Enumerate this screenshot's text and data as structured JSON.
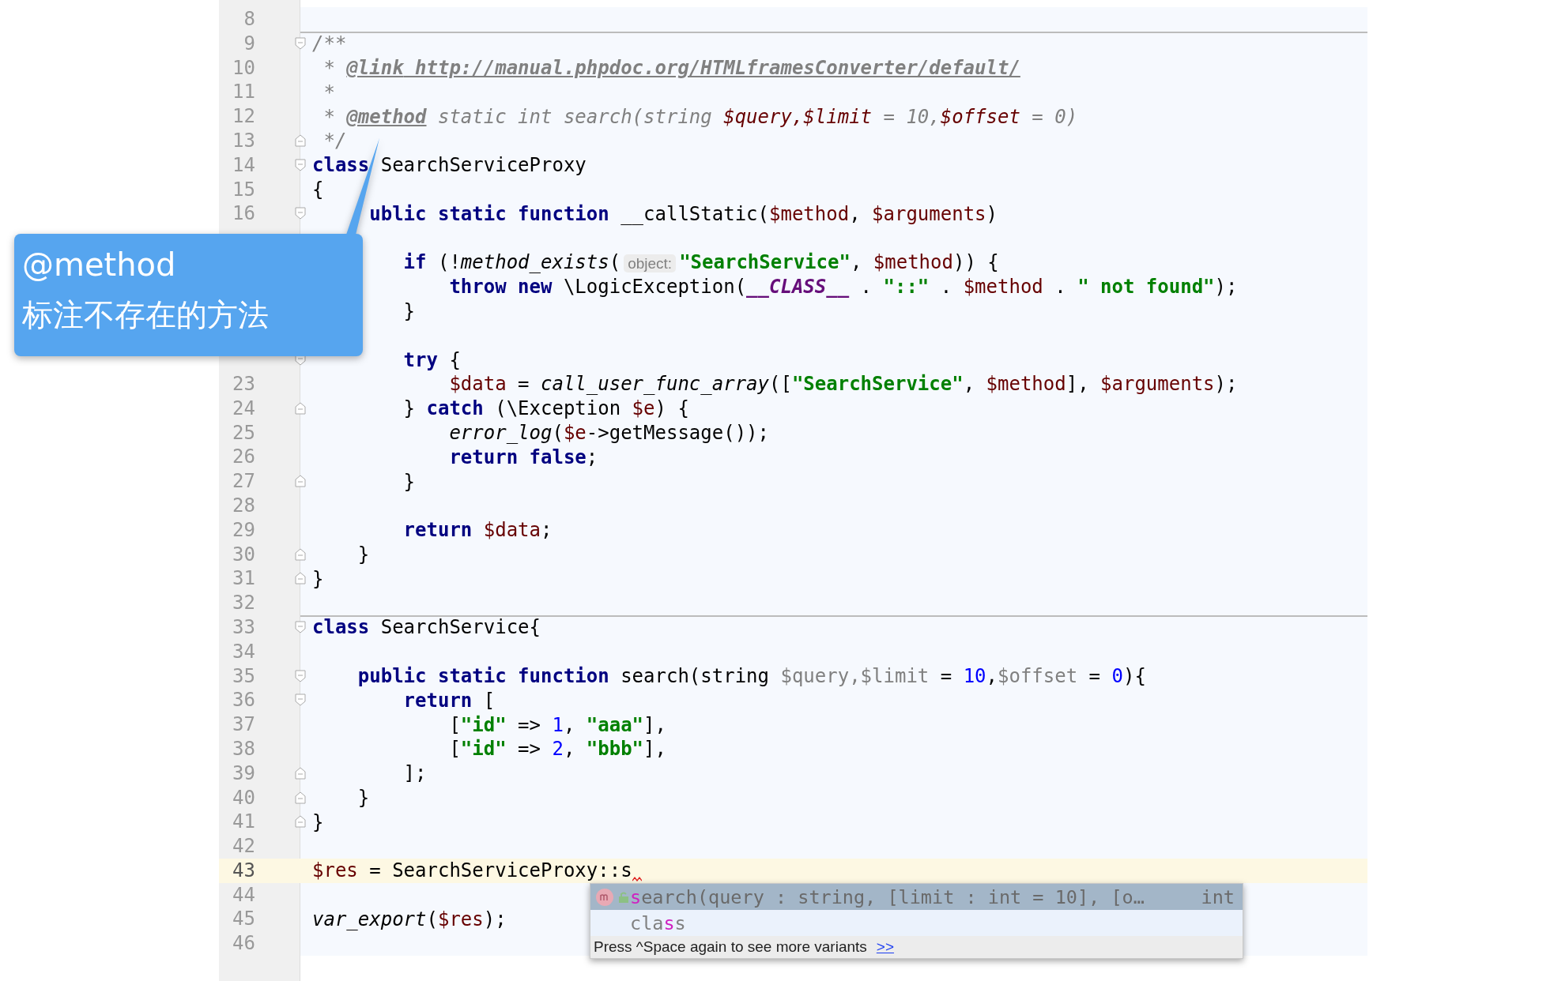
{
  "editor": {
    "lines": [
      {
        "number": "8",
        "fold_start": false,
        "fold_end": false,
        "separator": false,
        "current": false,
        "error_mark": false
      },
      {
        "number": "9",
        "fold_start": true,
        "fold_end": false,
        "separator": true,
        "current": false,
        "error_mark": false,
        "tokens": [
          {
            "kind": "comment",
            "text": "/**"
          }
        ]
      },
      {
        "number": "10",
        "fold_start": false,
        "fold_end": false,
        "separator": false,
        "current": false,
        "error_mark": false,
        "tokens": [
          {
            "kind": "comment",
            "text": " * "
          },
          {
            "kind": "doctag",
            "text": "@link"
          },
          {
            "kind": "doctag",
            "text": " http://manual.phpdoc.org/HTMLframesConverter/default/"
          }
        ]
      },
      {
        "number": "11",
        "fold_start": false,
        "fold_end": false,
        "separator": false,
        "current": false,
        "error_mark": false,
        "tokens": [
          {
            "kind": "comment",
            "text": " *"
          }
        ]
      },
      {
        "number": "12",
        "fold_start": false,
        "fold_end": false,
        "separator": false,
        "current": false,
        "error_mark": false,
        "tokens": [
          {
            "kind": "comment",
            "text": " * "
          },
          {
            "kind": "doctag",
            "text": "@method"
          },
          {
            "kind": "comment",
            "text": " static int search(string "
          },
          {
            "kind": "docvar",
            "text": "$query,$limit"
          },
          {
            "kind": "comment",
            "text": " = 10,"
          },
          {
            "kind": "docvar",
            "text": "$offset"
          },
          {
            "kind": "comment",
            "text": " = 0)"
          }
        ]
      },
      {
        "number": "13",
        "fold_start": false,
        "fold_end": true,
        "separator": false,
        "current": false,
        "error_mark": false,
        "tokens": [
          {
            "kind": "comment",
            "text": " */"
          }
        ]
      },
      {
        "number": "14",
        "fold_start": true,
        "fold_end": false,
        "separator": false,
        "current": false,
        "error_mark": false,
        "tokens": [
          {
            "kind": "keyword",
            "text": "class"
          },
          {
            "kind": "plain",
            "text": " SearchServiceProxy"
          }
        ]
      },
      {
        "number": "15",
        "fold_start": false,
        "fold_end": false,
        "separator": false,
        "current": false,
        "error_mark": false,
        "tokens": [
          {
            "kind": "plain",
            "text": "{"
          }
        ]
      },
      {
        "number": "16",
        "fold_start": true,
        "fold_end": false,
        "separator": false,
        "current": false,
        "error_mark": false,
        "tokens": [
          {
            "kind": "keyword",
            "text": "     ublic"
          },
          {
            "kind": "keyword",
            "text": " static"
          },
          {
            "kind": "keyword",
            "text": " function"
          },
          {
            "kind": "plain",
            "text": " __callStatic("
          },
          {
            "kind": "variable",
            "text": "$method"
          },
          {
            "kind": "plain",
            "text": ", "
          },
          {
            "kind": "variable",
            "text": "$arguments"
          },
          {
            "kind": "plain",
            "text": ")"
          }
        ]
      },
      {
        "fold_start": false,
        "fold_end": false,
        "separator": false,
        "current": false,
        "error_mark": false
      },
      {
        "fold_start": false,
        "fold_end": false,
        "separator": false,
        "current": false,
        "error_mark": false,
        "tokens": [
          {
            "kind": "keyword",
            "text": "        if"
          },
          {
            "kind": "plain",
            "text": " (!"
          },
          {
            "kind": "function",
            "text": "method_exists"
          },
          {
            "kind": "plain",
            "text": "("
          },
          {
            "kind": "hint",
            "text": "object:"
          },
          {
            "kind": "string",
            "text": "\"SearchService\""
          },
          {
            "kind": "plain",
            "text": ", "
          },
          {
            "kind": "variable",
            "text": "$method"
          },
          {
            "kind": "plain",
            "text": ")) {"
          }
        ]
      },
      {
        "fold_start": false,
        "fold_end": false,
        "separator": false,
        "current": false,
        "error_mark": false,
        "tokens": [
          {
            "kind": "keyword",
            "text": "            throw"
          },
          {
            "kind": "keyword",
            "text": " new"
          },
          {
            "kind": "plain",
            "text": " \\LogicException("
          },
          {
            "kind": "constant",
            "text": "__CLASS__"
          },
          {
            "kind": "plain",
            "text": " . "
          },
          {
            "kind": "string",
            "text": "\"::\""
          },
          {
            "kind": "plain",
            "text": " . "
          },
          {
            "kind": "variable",
            "text": "$method"
          },
          {
            "kind": "plain",
            "text": " . "
          },
          {
            "kind": "string",
            "text": "\" not found\""
          },
          {
            "kind": "plain",
            "text": ");"
          }
        ]
      },
      {
        "fold_start": false,
        "fold_end": false,
        "separator": false,
        "current": false,
        "error_mark": false,
        "tokens": [
          {
            "kind": "plain",
            "text": "        }"
          }
        ]
      },
      {
        "fold_start": false,
        "fold_end": false,
        "separator": false,
        "current": false,
        "error_mark": false
      },
      {
        "fold_start": true,
        "fold_end": false,
        "separator": false,
        "current": false,
        "error_mark": false,
        "tokens": [
          {
            "kind": "keyword",
            "text": "        try"
          },
          {
            "kind": "plain",
            "text": " {"
          }
        ]
      },
      {
        "number": "23",
        "fold_start": false,
        "fold_end": false,
        "separator": false,
        "current": false,
        "error_mark": false,
        "tokens": [
          {
            "kind": "variable",
            "text": "            $data"
          },
          {
            "kind": "plain",
            "text": " = "
          },
          {
            "kind": "function",
            "text": "call_user_func_array"
          },
          {
            "kind": "plain",
            "text": "(["
          },
          {
            "kind": "string",
            "text": "\"SearchService\""
          },
          {
            "kind": "plain",
            "text": ", "
          },
          {
            "kind": "variable",
            "text": "$method"
          },
          {
            "kind": "plain",
            "text": "], "
          },
          {
            "kind": "variable",
            "text": "$arguments"
          },
          {
            "kind": "plain",
            "text": ");"
          }
        ]
      },
      {
        "number": "24",
        "fold_start": false,
        "fold_end": true,
        "separator": false,
        "current": false,
        "error_mark": false,
        "tokens": [
          {
            "kind": "plain",
            "text": "        } "
          },
          {
            "kind": "keyword",
            "text": "catch"
          },
          {
            "kind": "plain",
            "text": " (\\Exception "
          },
          {
            "kind": "variable",
            "text": "$e"
          },
          {
            "kind": "plain",
            "text": ") {"
          }
        ]
      },
      {
        "number": "25",
        "fold_start": false,
        "fold_end": false,
        "separator": false,
        "current": false,
        "error_mark": false,
        "tokens": [
          {
            "kind": "function",
            "text": "            error_log"
          },
          {
            "kind": "plain",
            "text": "("
          },
          {
            "kind": "variable",
            "text": "$e"
          },
          {
            "kind": "plain",
            "text": "->getMessage());"
          }
        ]
      },
      {
        "number": "26",
        "fold_start": false,
        "fold_end": false,
        "separator": false,
        "current": false,
        "error_mark": false,
        "tokens": [
          {
            "kind": "keyword",
            "text": "            return"
          },
          {
            "kind": "keyword",
            "text": " false"
          },
          {
            "kind": "plain",
            "text": ";"
          }
        ]
      },
      {
        "number": "27",
        "fold_start": false,
        "fold_end": true,
        "separator": false,
        "current": false,
        "error_mark": false,
        "tokens": [
          {
            "kind": "plain",
            "text": "        }"
          }
        ]
      },
      {
        "number": "28",
        "fold_start": false,
        "fold_end": false,
        "separator": false,
        "current": false,
        "error_mark": false
      },
      {
        "number": "29",
        "fold_start": false,
        "fold_end": false,
        "separator": false,
        "current": false,
        "error_mark": false,
        "tokens": [
          {
            "kind": "keyword",
            "text": "        return"
          },
          {
            "kind": "variable",
            "text": " $data"
          },
          {
            "kind": "plain",
            "text": ";"
          }
        ]
      },
      {
        "number": "30",
        "fold_start": false,
        "fold_end": true,
        "separator": false,
        "current": false,
        "error_mark": false,
        "tokens": [
          {
            "kind": "plain",
            "text": "    }"
          }
        ]
      },
      {
        "number": "31",
        "fold_start": false,
        "fold_end": true,
        "separator": false,
        "current": false,
        "error_mark": false,
        "tokens": [
          {
            "kind": "plain",
            "text": "}"
          }
        ]
      },
      {
        "number": "32",
        "fold_start": false,
        "fold_end": false,
        "separator": false,
        "current": false,
        "error_mark": false
      },
      {
        "number": "33",
        "fold_start": true,
        "fold_end": false,
        "separator": true,
        "current": false,
        "error_mark": false,
        "tokens": [
          {
            "kind": "keyword",
            "text": "class"
          },
          {
            "kind": "plain",
            "text": " SearchService{"
          }
        ]
      },
      {
        "number": "34",
        "fold_start": false,
        "fold_end": false,
        "separator": false,
        "current": false,
        "error_mark": false
      },
      {
        "number": "35",
        "fold_start": true,
        "fold_end": false,
        "separator": false,
        "current": false,
        "error_mark": false,
        "tokens": [
          {
            "kind": "keyword",
            "text": "    public"
          },
          {
            "kind": "keyword",
            "text": " static"
          },
          {
            "kind": "keyword",
            "text": " function"
          },
          {
            "kind": "plain",
            "text": " search(string "
          },
          {
            "kind": "unused",
            "text": "$query,$limit"
          },
          {
            "kind": "plain",
            "text": " = "
          },
          {
            "kind": "number",
            "text": "10"
          },
          {
            "kind": "plain",
            "text": ","
          },
          {
            "kind": "unused",
            "text": "$offset"
          },
          {
            "kind": "plain",
            "text": " = "
          },
          {
            "kind": "number",
            "text": "0"
          },
          {
            "kind": "plain",
            "text": "){"
          }
        ]
      },
      {
        "number": "36",
        "fold_start": true,
        "fold_end": false,
        "separator": false,
        "current": false,
        "error_mark": false,
        "tokens": [
          {
            "kind": "keyword",
            "text": "        return"
          },
          {
            "kind": "plain",
            "text": " ["
          }
        ]
      },
      {
        "number": "37",
        "fold_start": false,
        "fold_end": false,
        "separator": false,
        "current": false,
        "error_mark": false,
        "tokens": [
          {
            "kind": "plain",
            "text": "            ["
          },
          {
            "kind": "string",
            "text": "\"id\""
          },
          {
            "kind": "plain",
            "text": " => "
          },
          {
            "kind": "number",
            "text": "1"
          },
          {
            "kind": "plain",
            "text": ", "
          },
          {
            "kind": "string",
            "text": "\"aaa\""
          },
          {
            "kind": "plain",
            "text": "],"
          }
        ]
      },
      {
        "number": "38",
        "fold_start": false,
        "fold_end": false,
        "separator": false,
        "current": false,
        "error_mark": false,
        "tokens": [
          {
            "kind": "plain",
            "text": "            ["
          },
          {
            "kind": "string",
            "text": "\"id\""
          },
          {
            "kind": "plain",
            "text": " => "
          },
          {
            "kind": "number",
            "text": "2"
          },
          {
            "kind": "plain",
            "text": ", "
          },
          {
            "kind": "string",
            "text": "\"bbb\""
          },
          {
            "kind": "plain",
            "text": "],"
          }
        ]
      },
      {
        "number": "39",
        "fold_start": false,
        "fold_end": true,
        "separator": false,
        "current": false,
        "error_mark": false,
        "tokens": [
          {
            "kind": "plain",
            "text": "        ];"
          }
        ]
      },
      {
        "number": "40",
        "fold_start": false,
        "fold_end": true,
        "separator": false,
        "current": false,
        "error_mark": false,
        "tokens": [
          {
            "kind": "plain",
            "text": "    }"
          }
        ]
      },
      {
        "number": "41",
        "fold_start": false,
        "fold_end": true,
        "separator": false,
        "current": false,
        "error_mark": false,
        "tokens": [
          {
            "kind": "plain",
            "text": "}"
          }
        ]
      },
      {
        "number": "42",
        "fold_start": false,
        "fold_end": false,
        "separator": false,
        "current": false,
        "error_mark": false
      },
      {
        "number": "43",
        "fold_start": false,
        "fold_end": false,
        "separator": false,
        "current": true,
        "error_mark": true,
        "tokens": [
          {
            "kind": "variable",
            "text": "$res"
          },
          {
            "kind": "plain",
            "text": " = SearchServiceProxy::s"
          }
        ]
      },
      {
        "number": "44",
        "fold_start": false,
        "fold_end": false,
        "separator": false,
        "current": false,
        "error_mark": false
      },
      {
        "number": "45",
        "fold_start": false,
        "fold_end": false,
        "separator": false,
        "current": false,
        "error_mark": false,
        "tokens": [
          {
            "kind": "function",
            "text": "var_export"
          },
          {
            "kind": "plain",
            "text": "("
          },
          {
            "kind": "variable",
            "text": "$res"
          },
          {
            "kind": "plain",
            "text": ");"
          }
        ]
      },
      {
        "number": "46",
        "fold_start": false,
        "fold_end": false,
        "separator": false,
        "current": false,
        "error_mark": false
      }
    ]
  },
  "completion_popup": {
    "items": [
      {
        "kind": "method",
        "selected": true,
        "match": "s",
        "after_match": "earch(query : string, [limit : int = 10], [o…",
        "type": "int"
      },
      {
        "kind": "keyword",
        "selected": false,
        "before_match": "cla",
        "match": "s",
        "after_match": "s"
      }
    ],
    "footer": {
      "text": "Press ^Space again to see more variants",
      "link": ">>"
    }
  },
  "callout": {
    "title": "@method",
    "text": "标注不存在的方法"
  }
}
